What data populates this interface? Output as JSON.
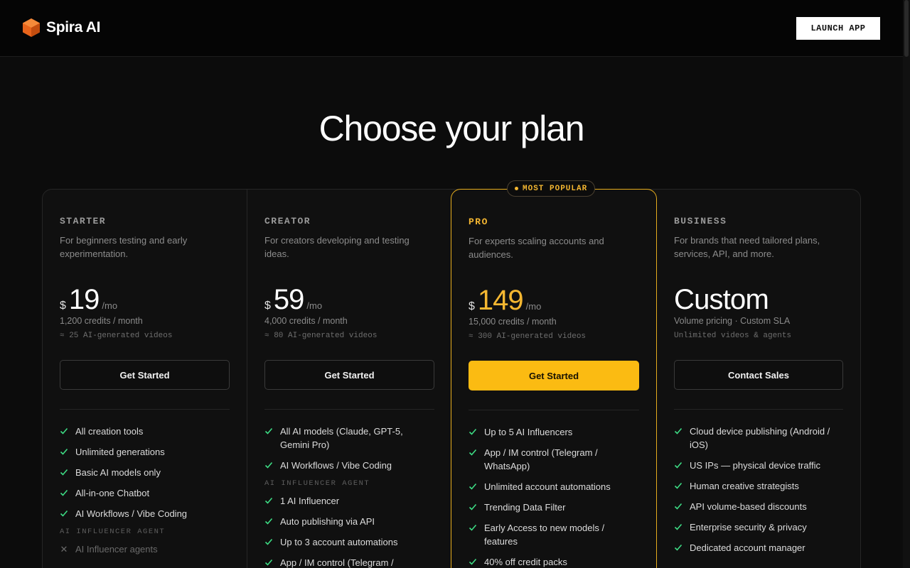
{
  "header": {
    "brand": "Spira AI",
    "launch_label": "LAUNCH APP"
  },
  "main": {
    "title": "Choose your plan",
    "badge": "MOST POPULAR"
  },
  "plans": [
    {
      "tier": "STARTER",
      "description": "For beginners testing and early experimentation.",
      "currency": "$",
      "price": "19",
      "period": "/mo",
      "credits": "1,200 credits / month",
      "videos": "≈ 25 AI-generated videos",
      "cta": "Get Started",
      "features": [
        "All creation tools",
        "Unlimited generations",
        "Basic AI models only",
        "All-in-one Chatbot",
        "AI Workflows / Vibe Coding"
      ],
      "section": "AI INFLUENCER AGENT",
      "section_features": [
        "AI Influencer agents"
      ]
    },
    {
      "tier": "CREATOR",
      "description": "For creators developing and testing ideas.",
      "currency": "$",
      "price": "59",
      "period": "/mo",
      "credits": "4,000 credits / month",
      "videos": "≈ 80 AI-generated videos",
      "cta": "Get Started",
      "features": [
        "All AI models (Claude, GPT-5, Gemini Pro)",
        "AI Workflows / Vibe Coding"
      ],
      "section": "AI INFLUENCER AGENT",
      "section_features": [
        "1 AI Influencer",
        "Auto publishing via API",
        "Up to 3 account automations",
        "App / IM control (Telegram / WhatsApp)"
      ]
    },
    {
      "tier": "PRO",
      "description": "For experts scaling accounts and audiences.",
      "currency": "$",
      "price": "149",
      "period": "/mo",
      "credits": "15,000 credits / month",
      "videos": "≈ 300 AI-generated videos",
      "cta": "Get Started",
      "features": [
        "Up to 5 AI Influencers",
        "App / IM control (Telegram / WhatsApp)",
        "Unlimited account automations",
        "Trending Data Filter",
        "Early Access to new models / features",
        "40% off credit packs"
      ]
    },
    {
      "tier": "BUSINESS",
      "description": "For brands that need tailored plans, services, API, and more.",
      "price": "Custom",
      "credits": "Volume pricing · Custom SLA",
      "videos": "Unlimited videos & agents",
      "cta": "Contact Sales",
      "features": [
        "Cloud device publishing (Android / iOS)",
        "US IPs — physical device traffic",
        "Human creative strategists",
        "API volume-based discounts",
        "Enterprise security & privacy",
        "Dedicated account manager"
      ]
    }
  ],
  "colors": {
    "accent": "#fbbb12",
    "check": "#3ddc84",
    "background": "#0c0c0c"
  }
}
